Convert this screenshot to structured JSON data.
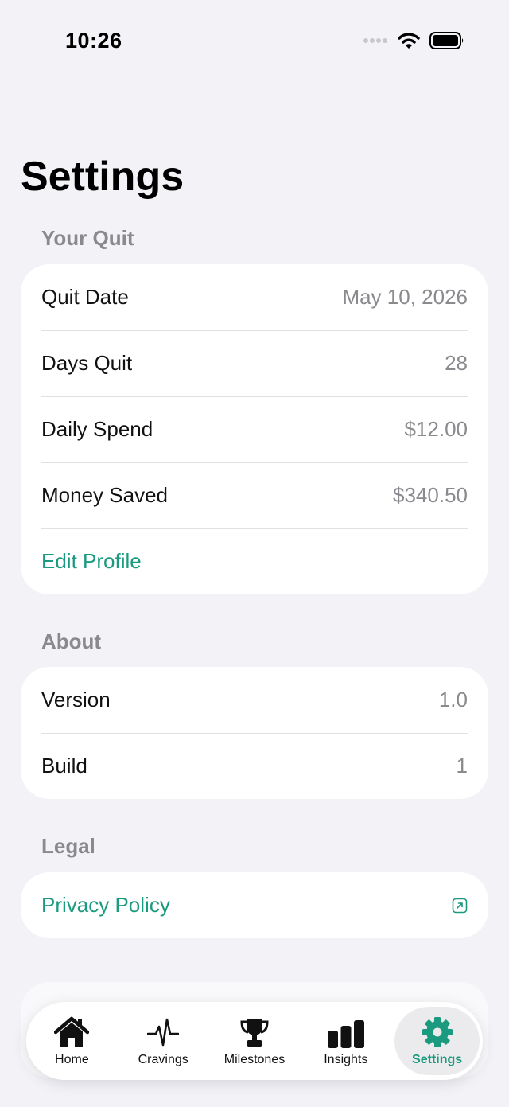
{
  "status_bar": {
    "time": "10:26"
  },
  "page": {
    "title": "Settings"
  },
  "sections": {
    "your_quit": {
      "header": "Your Quit",
      "rows": [
        {
          "label": "Quit Date",
          "value": "May 10, 2026"
        },
        {
          "label": "Days Quit",
          "value": "28"
        },
        {
          "label": "Daily Spend",
          "value": "$12.00"
        },
        {
          "label": "Money Saved",
          "value": "$340.50"
        }
      ],
      "edit_profile": "Edit Profile"
    },
    "about": {
      "header": "About",
      "rows": [
        {
          "label": "Version",
          "value": "1.0"
        },
        {
          "label": "Build",
          "value": "1"
        }
      ]
    },
    "legal": {
      "header": "Legal",
      "privacy_policy": "Privacy Policy"
    }
  },
  "tab_bar": {
    "tabs": [
      {
        "label": "Home",
        "icon": "house-icon"
      },
      {
        "label": "Cravings",
        "icon": "heartbeat-icon"
      },
      {
        "label": "Milestones",
        "icon": "trophy-icon"
      },
      {
        "label": "Insights",
        "icon": "bar-chart-icon"
      },
      {
        "label": "Settings",
        "icon": "gear-icon"
      }
    ],
    "active": "Settings"
  },
  "colors": {
    "accent": "#1a9a7e",
    "background": "#f2f2f7",
    "secondary_text": "#8a8a8e"
  }
}
